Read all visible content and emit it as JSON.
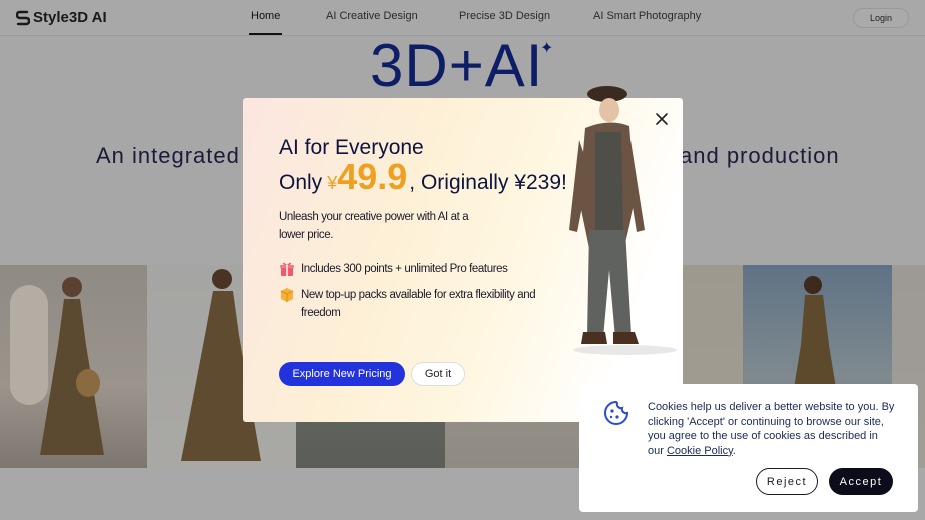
{
  "header": {
    "logo_text": "Style3D AI",
    "nav": [
      {
        "label": "Home",
        "active": true
      },
      {
        "label": "AI Creative Design",
        "active": false
      },
      {
        "label": "Precise 3D Design",
        "active": false
      },
      {
        "label": "AI Smart Photography",
        "active": false
      }
    ],
    "login_label": "Login"
  },
  "hero": {
    "title": "3D+AI",
    "spark": "✦",
    "subtitle_left": "An integrated a",
    "subtitle_right": "and production"
  },
  "modal": {
    "title": "AI for Everyone",
    "price_prefix": "Only",
    "price_currency": "¥",
    "price_value": "49.9",
    "price_original": ", Originally ¥239!",
    "description": "Unleash your creative power with AI at a lower price.",
    "features": [
      {
        "icon": "gift-icon",
        "text": "Includes 300 points + unlimited Pro features"
      },
      {
        "icon": "package-icon",
        "text": "New top-up packs available for extra flexibility and freedom"
      }
    ],
    "explore_label": "Explore New Pricing",
    "gotit_label": "Got it"
  },
  "cookie_banner": {
    "text": "Cookies help us deliver a better website to you. By clicking 'Accept' or continuing to browse our site, you agree to the use of cookies as described in our ",
    "link_text": "Cookie Policy",
    "trailing": ".",
    "reject_label": "Reject",
    "accept_label": "Accept"
  },
  "colors": {
    "brand_blue": "#2233dd",
    "price_orange": "#f0a020",
    "navy": "#0e1e66",
    "overlay_gray": "#a7a7a7"
  }
}
